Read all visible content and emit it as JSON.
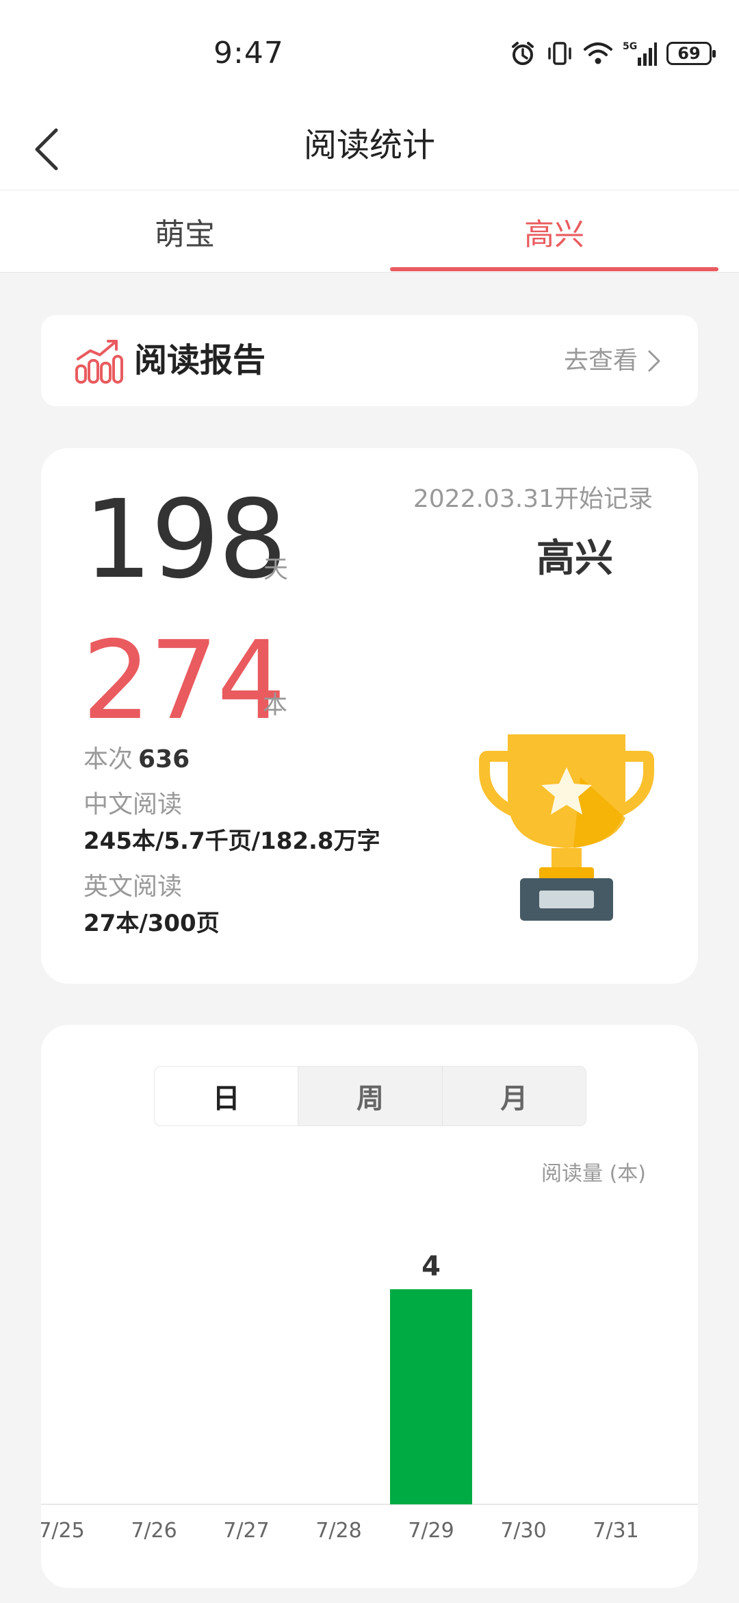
{
  "status": {
    "time": "9:47",
    "battery": "69",
    "network": "5G"
  },
  "header": {
    "title": "阅读统计"
  },
  "tabs": [
    {
      "label": "萌宝",
      "active": false
    },
    {
      "label": "高兴",
      "active": true
    }
  ],
  "accent_color": "#e95b5f",
  "report": {
    "title": "阅读报告",
    "link": "去查看"
  },
  "stats": {
    "days": "198",
    "days_unit": "天",
    "since": "2022.03.31开始记录",
    "name": "高兴",
    "books": "274",
    "books_unit": "本",
    "times_label": "本次",
    "times_value": "636",
    "chinese_label": "中文阅读",
    "chinese_value": "245本/5.7千页/182.8万字",
    "english_label": "英文阅读",
    "english_value": "27本/300页"
  },
  "chart": {
    "segments": [
      "日",
      "周",
      "月"
    ],
    "active_segment": "日",
    "ylabel": "阅读量 (本)"
  },
  "chart_data": {
    "type": "bar",
    "categories": [
      "7/25",
      "7/26",
      "7/27",
      "7/28",
      "7/29",
      "7/30",
      "7/31"
    ],
    "values": [
      0,
      0,
      0,
      0,
      4,
      0,
      0
    ],
    "ylabel": "阅读量 (本)",
    "bar_color": "#00ab43",
    "grid": false
  }
}
